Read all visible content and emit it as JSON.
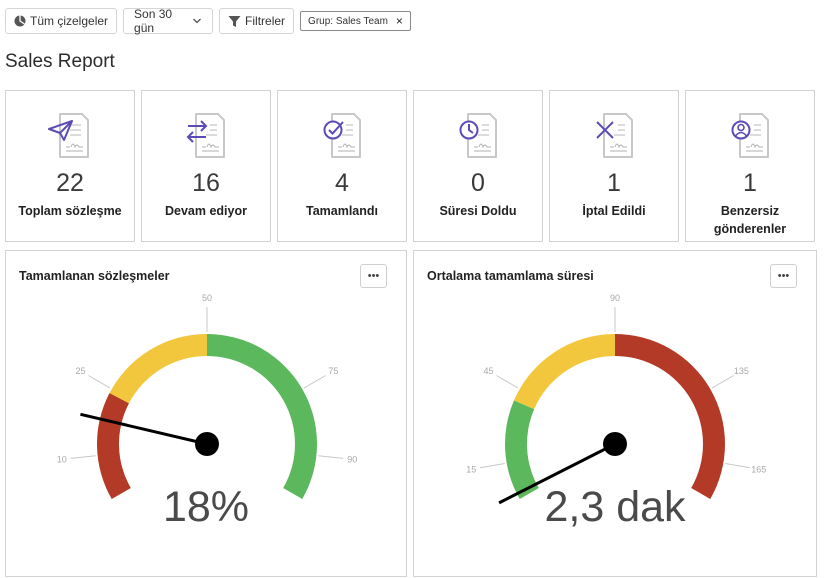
{
  "toolbar": {
    "all_charts_label": "Tüm çizelgeler",
    "date_range_label": "Son 30 gün",
    "filters_label": "Filtreler",
    "filter_chip_label": "Grup: Sales Team",
    "chip_close_glyph": "×"
  },
  "page_title": "Sales Report",
  "colors": {
    "accent_purple": "#5a4bb5",
    "red": "#b23a26",
    "yellow": "#f3c73d",
    "green": "#5cb85c"
  },
  "kpis": [
    {
      "value": "22",
      "label": "Toplam sözleşme",
      "icon": "send-icon"
    },
    {
      "value": "16",
      "label": "Devam ediyor",
      "icon": "arrows-exchange-icon"
    },
    {
      "value": "4",
      "label": "Tamamlandı",
      "icon": "check-circle-icon"
    },
    {
      "value": "0",
      "label": "Süresi Doldu",
      "icon": "clock-icon"
    },
    {
      "value": "1",
      "label": "İptal Edildi",
      "icon": "x-icon"
    },
    {
      "value": "1",
      "label": "Benzersiz gönderenler",
      "icon": "user-circle-icon"
    }
  ],
  "panels": {
    "left": {
      "title": "Tamamlanan sözleşmeler",
      "more_label": "•••",
      "value_text": "18%"
    },
    "right": {
      "title": "Ortalama tamamlama süresi",
      "more_label": "•••",
      "value_text": "2,3 dak"
    }
  },
  "chart_data": [
    {
      "type": "gauge",
      "title": "Tamamlanan sözleşmeler",
      "min": 0,
      "max": 100,
      "value": 18,
      "value_label": "18%",
      "ticks": [
        10,
        25,
        50,
        75,
        90
      ],
      "bands": [
        {
          "from": 0,
          "to": 24,
          "color": "#b23a26"
        },
        {
          "from": 24,
          "to": 50,
          "color": "#f3c73d"
        },
        {
          "from": 50,
          "to": 100,
          "color": "#5cb85c"
        }
      ]
    },
    {
      "type": "gauge",
      "title": "Ortalama tamamlama süresi",
      "min": 0,
      "max": 180,
      "value": 2.3,
      "value_label": "2,3 dak",
      "ticks": [
        15,
        45,
        90,
        135,
        165
      ],
      "bands": [
        {
          "from": 0,
          "to": 40,
          "color": "#5cb85c"
        },
        {
          "from": 40,
          "to": 90,
          "color": "#f3c73d"
        },
        {
          "from": 90,
          "to": 180,
          "color": "#b23a26"
        }
      ]
    }
  ]
}
